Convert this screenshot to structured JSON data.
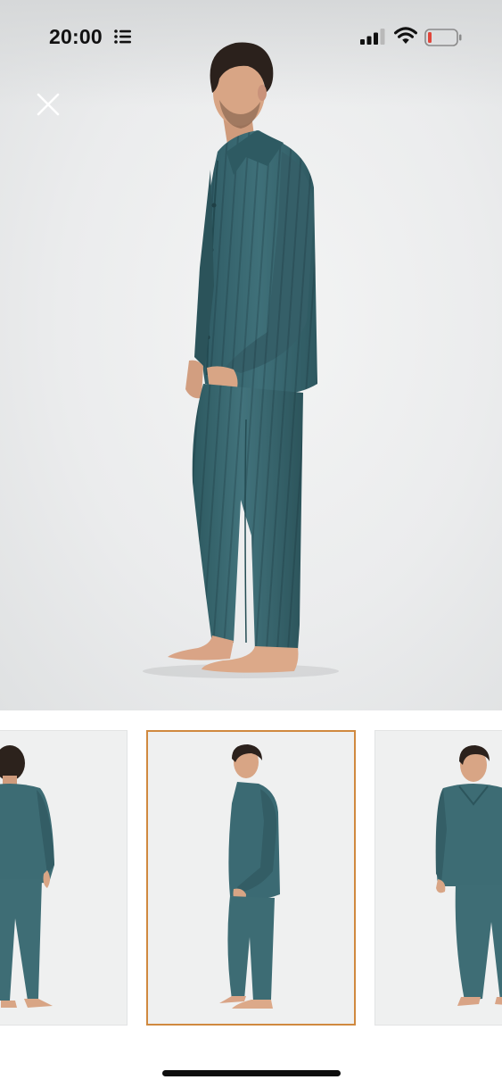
{
  "status_bar": {
    "time": "20:00",
    "icons": [
      "list-icon",
      "signal-icon",
      "wifi-icon",
      "battery-icon"
    ],
    "battery_color": "#e0463b"
  },
  "viewer": {
    "close_icon": "close-icon",
    "main_image": "model-front-threequarter"
  },
  "gallery": {
    "thumbnails": [
      {
        "name": "thumbnail-back-view",
        "selected": false
      },
      {
        "name": "thumbnail-side-view",
        "selected": true
      },
      {
        "name": "thumbnail-front-view",
        "selected": false
      }
    ],
    "selected_border_color": "#d0893f"
  },
  "colors": {
    "garment": "#3c6b74",
    "garment_dark": "#2c535b",
    "skin": "#d8a585",
    "hair": "#2b211c"
  }
}
